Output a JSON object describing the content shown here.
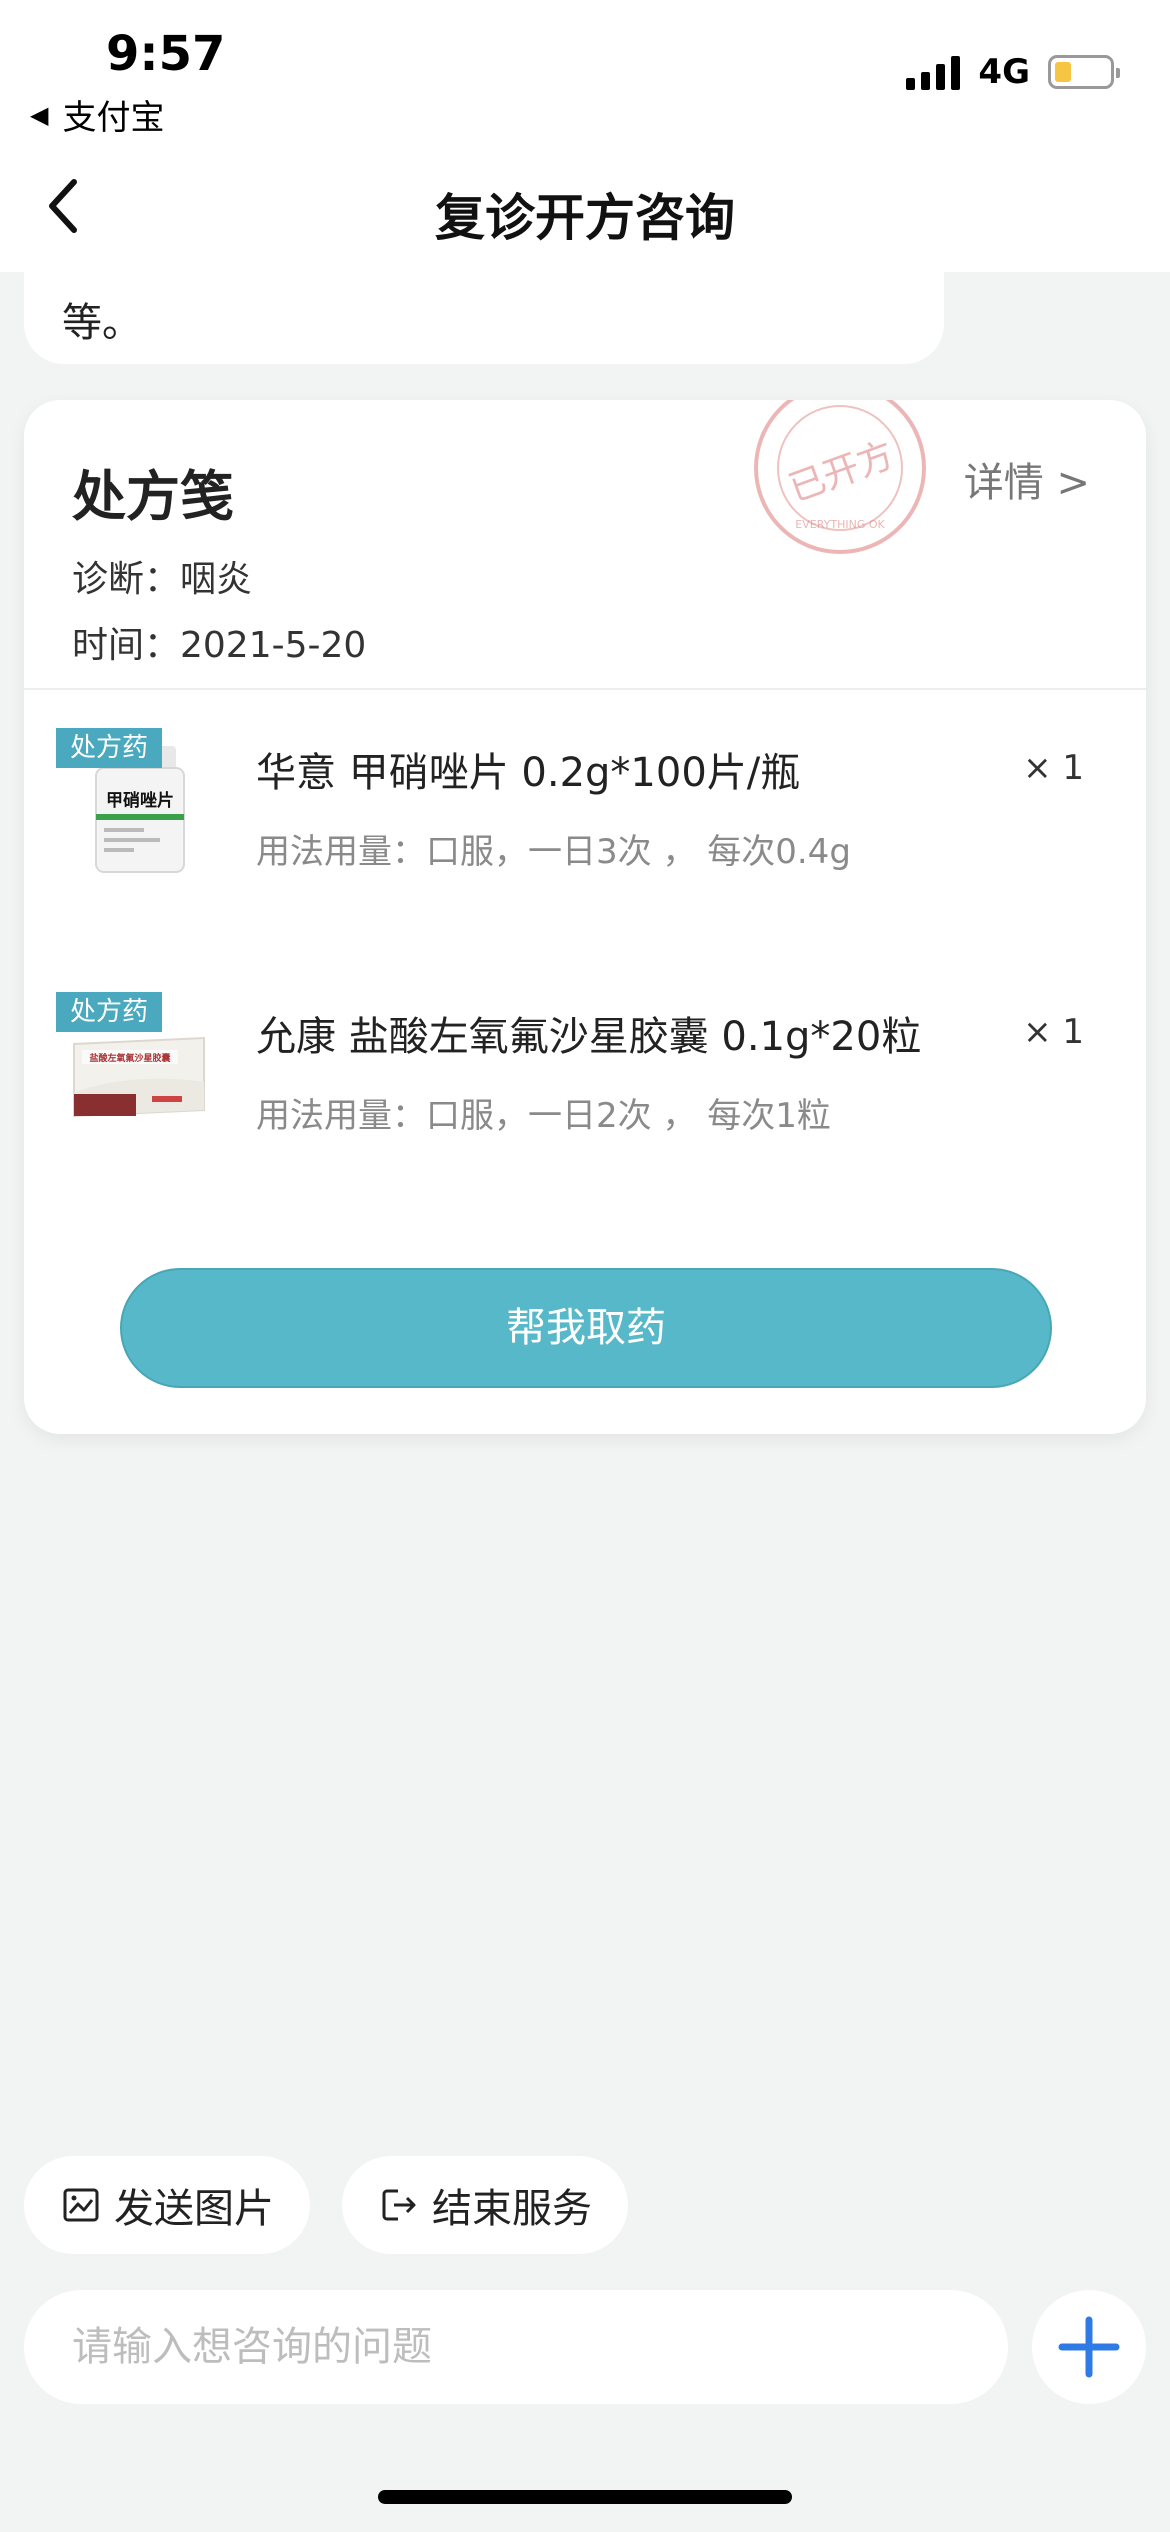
{
  "status_bar": {
    "time": "9:57",
    "back_app": "支付宝",
    "network": "4G",
    "battery_level": 0.2
  },
  "header": {
    "title": "复诊开方咨询"
  },
  "prev_message": {
    "text": "等。"
  },
  "prescription": {
    "title": "处方笺",
    "detail_link": "详情 >",
    "stamp_text": "已开方",
    "stamp_ring_text": "EVERYTHING OK",
    "diagnosis": "诊断：咽炎",
    "time": "时间：2021-5-20",
    "drugs": [
      {
        "tag": "处方药",
        "name": "华意 甲硝唑片 0.2g*100片/瓶",
        "quantity": "× 1",
        "usage": "用法用量：口服，一日3次 ， 每次0.4g",
        "image_label": "甲硝唑片"
      },
      {
        "tag": "处方药",
        "name": "允康 盐酸左氧氟沙星胶囊 0.1g*20粒",
        "quantity": "× 1",
        "usage": "用法用量：口服，一日2次 ， 每次1粒",
        "image_label": "盐酸左氧氟沙星胶囊"
      }
    ],
    "action_button": "帮我取药"
  },
  "quick_actions": {
    "send_image": "发送图片",
    "end_service": "结束服务"
  },
  "input": {
    "placeholder": "请输入想咨询的问题"
  },
  "colors": {
    "accent": "#56b8c8",
    "tag": "#4aa9bf",
    "plus": "#2f7be5",
    "stamp": "#e08585"
  }
}
